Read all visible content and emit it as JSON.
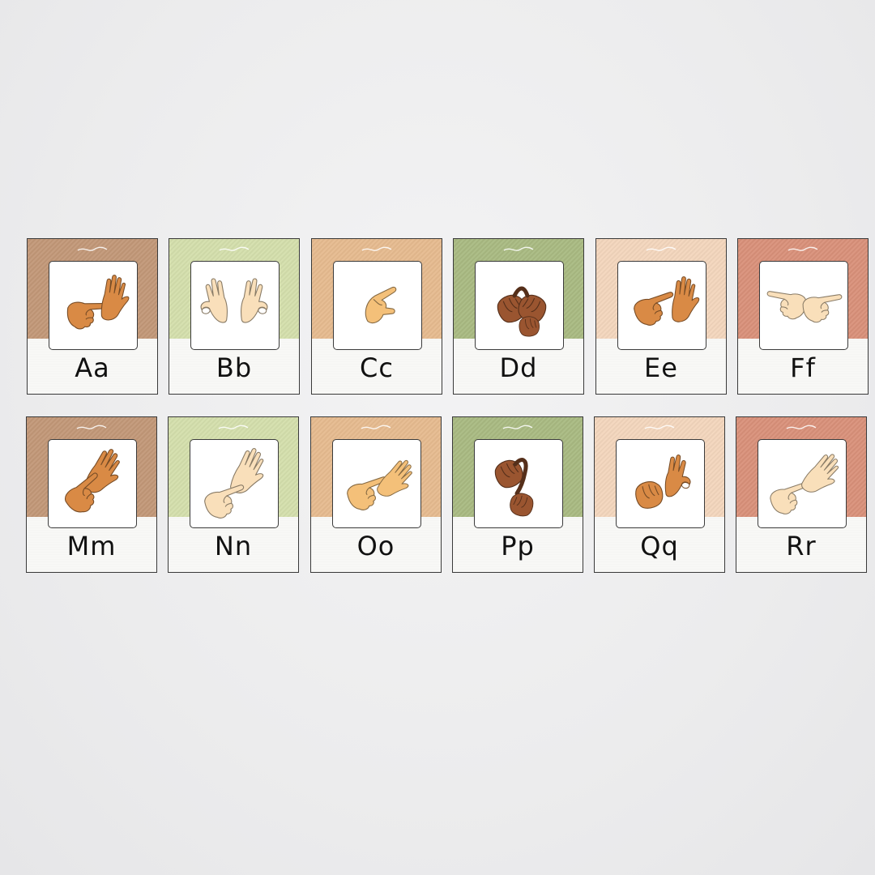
{
  "cards": [
    {
      "letters": "Aa",
      "band_color": "#c29878",
      "skin": "#d98a45",
      "icon": "sign-a-hands-icon"
    },
    {
      "letters": "Bb",
      "band_color": "#d4dfac",
      "skin": "#f9dfba",
      "icon": "sign-b-hands-icon"
    },
    {
      "letters": "Cc",
      "band_color": "#e6bb8f",
      "skin": "#f4c079",
      "icon": "sign-c-hand-icon"
    },
    {
      "letters": "Dd",
      "band_color": "#a9ba82",
      "skin": "#9a5530",
      "icon": "sign-d-hands-icon"
    },
    {
      "letters": "Ee",
      "band_color": "#f3d6bd",
      "skin": "#d98a45",
      "icon": "sign-e-hands-icon"
    },
    {
      "letters": "Ff",
      "band_color": "#d9917a",
      "skin": "#f9dfba",
      "icon": "sign-f-hands-icon"
    },
    {
      "letters": "Mm",
      "band_color": "#c29878",
      "skin": "#d98a45",
      "icon": "sign-m-hands-icon"
    },
    {
      "letters": "Nn",
      "band_color": "#d4dfac",
      "skin": "#f9dfba",
      "icon": "sign-n-hands-icon"
    },
    {
      "letters": "Oo",
      "band_color": "#e6bb8f",
      "skin": "#f4c079",
      "icon": "sign-o-hands-icon"
    },
    {
      "letters": "Pp",
      "band_color": "#a9ba82",
      "skin": "#9a5530",
      "icon": "sign-p-hands-icon"
    },
    {
      "letters": "Qq",
      "band_color": "#f3d6bd",
      "skin": "#d98a45",
      "icon": "sign-q-hands-icon"
    },
    {
      "letters": "Rr",
      "band_color": "#d9917a",
      "skin": "#f9dfba",
      "icon": "sign-r-hands-icon"
    }
  ]
}
